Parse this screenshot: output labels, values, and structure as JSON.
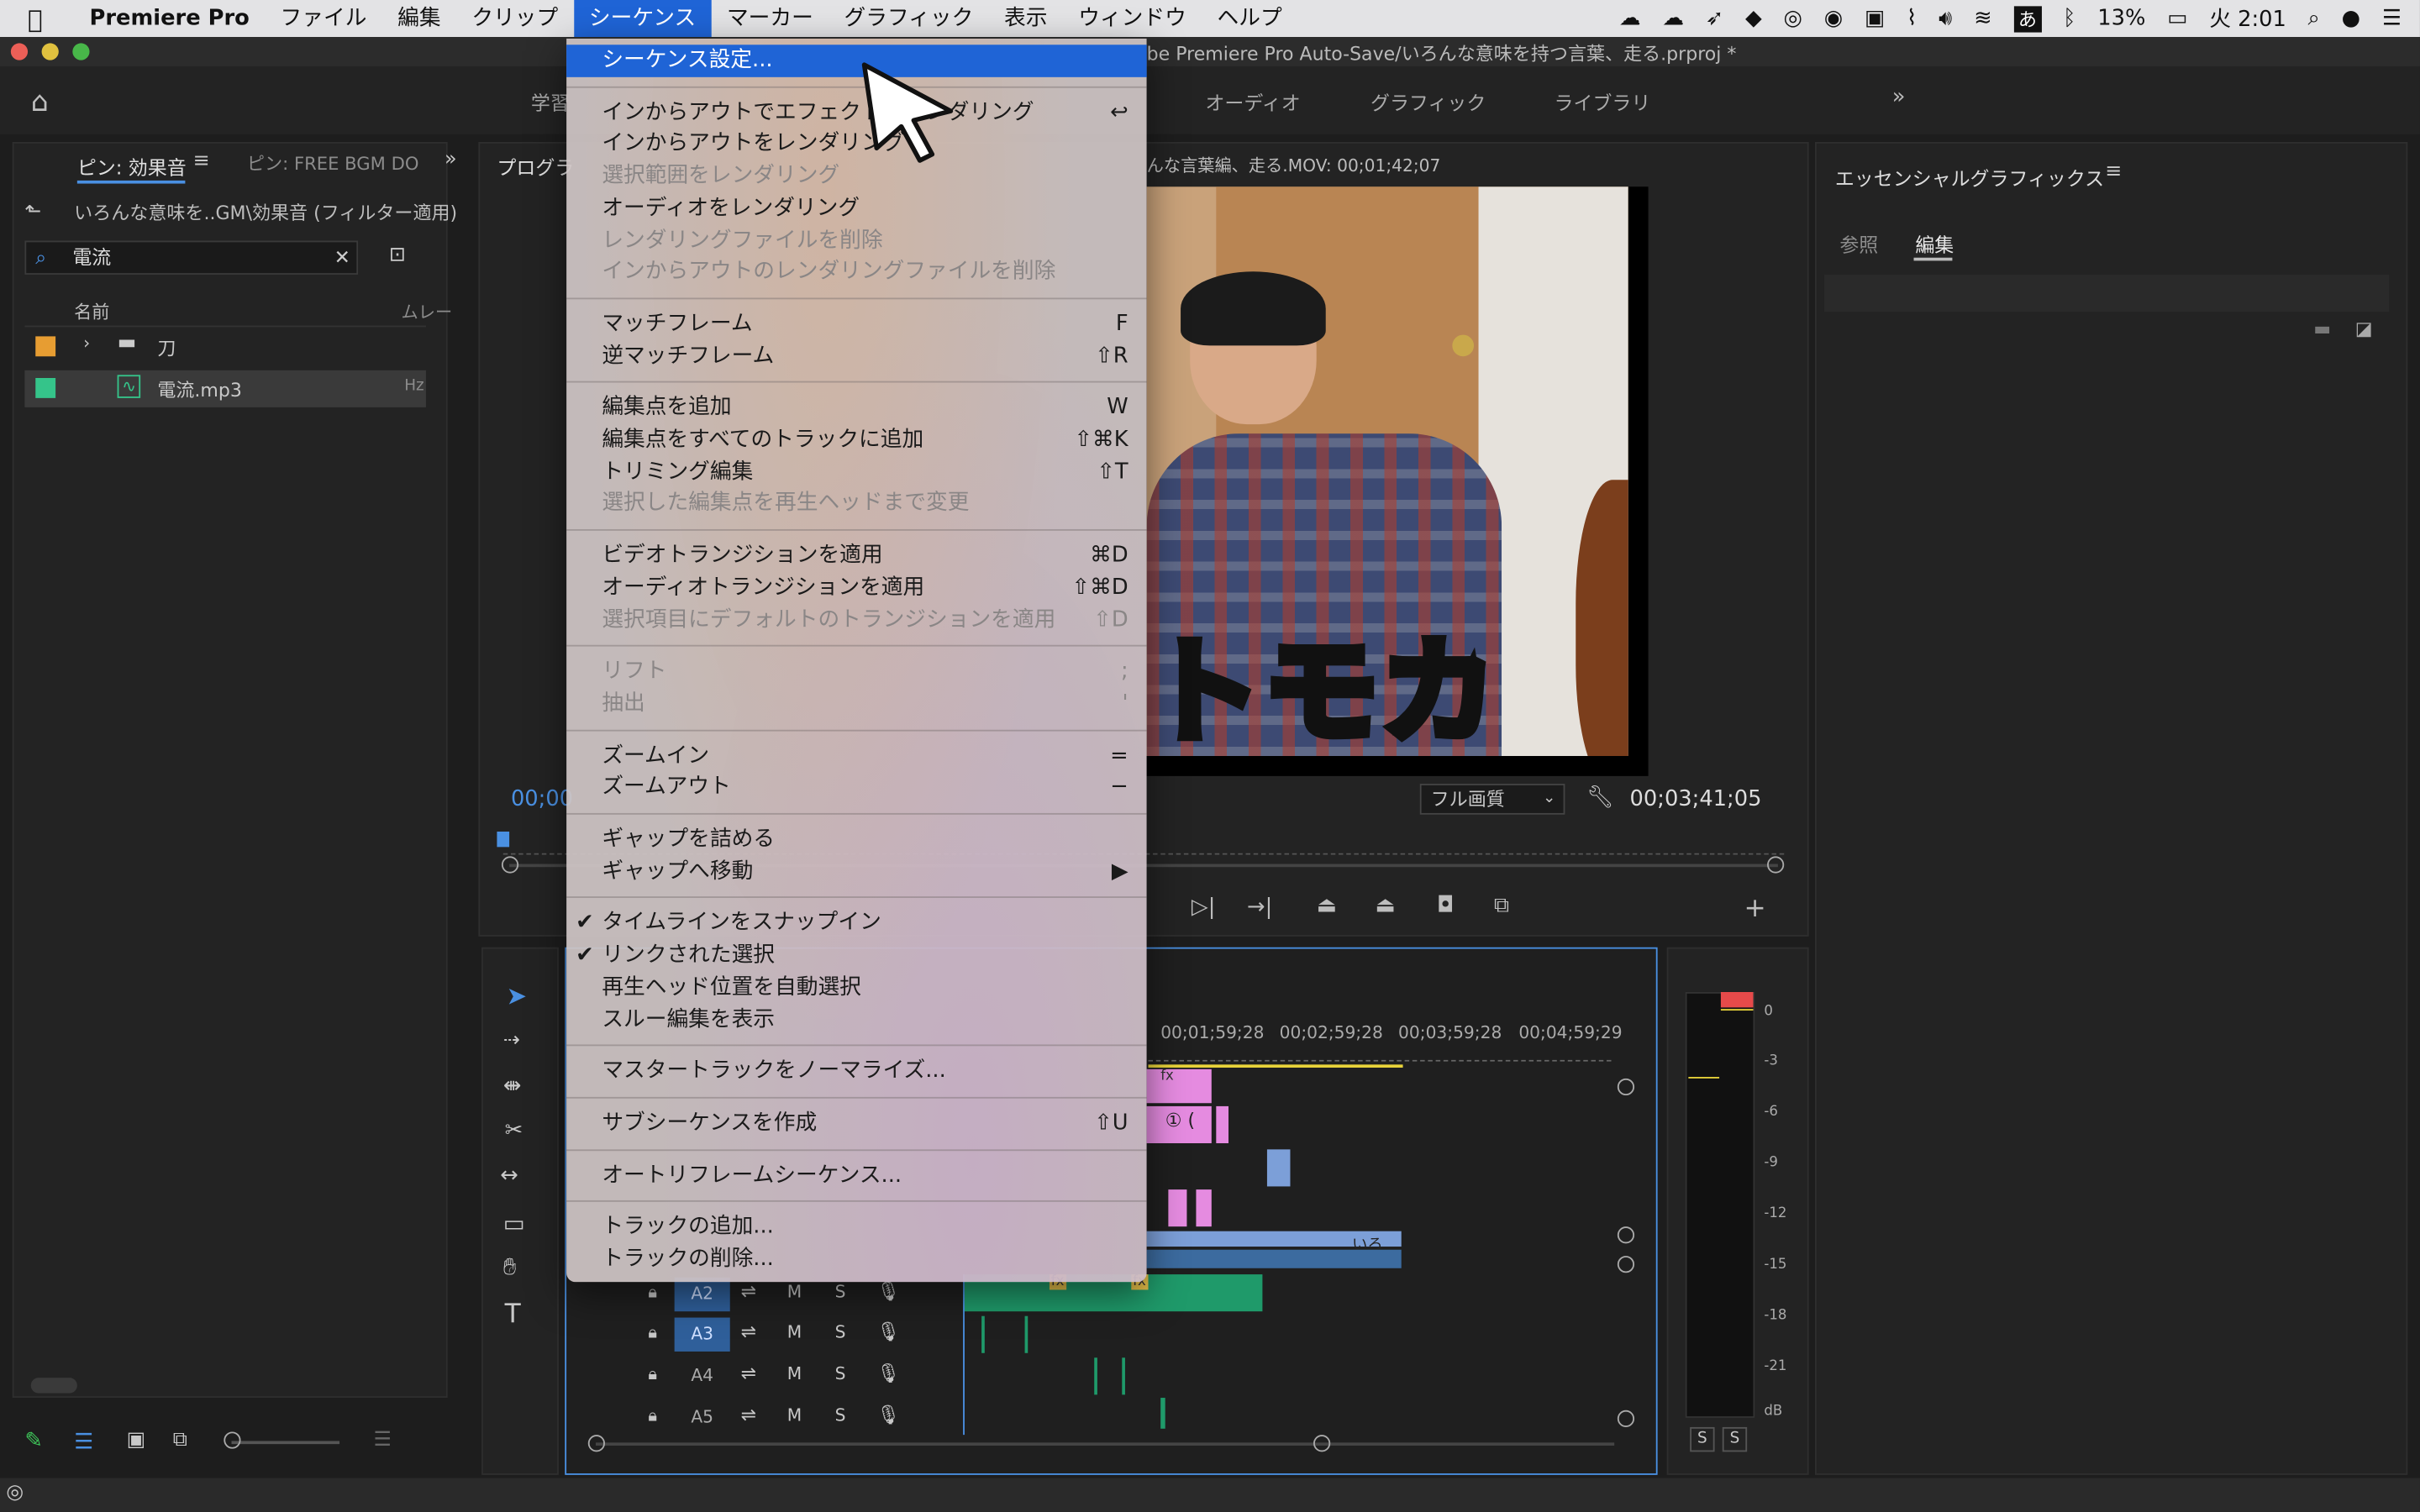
{
  "menubar": {
    "app_name": "Premiere Pro",
    "items": [
      "ファイル",
      "編集",
      "クリップ",
      "シーケンス",
      "マーカー",
      "グラフィック",
      "表示",
      "ウィンドウ",
      "ヘルプ"
    ],
    "active_item": "シーケンス",
    "battery": "13%",
    "ime": "あ",
    "clock": "火 2:01"
  },
  "window": {
    "title": "be Premiere Pro Auto-Save/いろんな意味を持つ言葉、走る.prproj *"
  },
  "workspaces": [
    "学習",
    "オーディオ",
    "グラフィック",
    "ライブラリ"
  ],
  "project": {
    "tab_active": "ピン: 効果音",
    "tab_other": "ピン: FREE BGM DO",
    "path": "いろんな意味を..GM\\効果音 (フィルター適用)",
    "search_value": "電流",
    "col_name": "名前",
    "col_frame": "ムレー",
    "rows": [
      {
        "name": "刀",
        "color": "#e79d32",
        "type": "folder"
      },
      {
        "name": "電流.mp3",
        "color": "#35c48a",
        "type": "audio",
        "extra": "Hz"
      }
    ]
  },
  "program": {
    "tab": "プログラ",
    "clip_title": "んな言葉編、走る.MOV: 00;01;42;07",
    "caption": "トモカ",
    "timecode_left": "00;00",
    "quality": "フル画質",
    "timecode_right": "00;03;41;05"
  },
  "essential_graphics": {
    "title": "エッセンシャルグラフィックス",
    "tab_browse": "参照",
    "tab_edit": "編集"
  },
  "timeline": {
    "ruler": [
      "00;01;59;28",
      "00;02;59;28",
      "00;03;59;28",
      "00;04;59;29"
    ],
    "tracks": [
      "A2",
      "A3",
      "A4",
      "A5"
    ],
    "track_m": "M",
    "track_s": "S",
    "clip_label_iro": "いろ",
    "clip_label_1": "① (",
    "fx": "fx"
  },
  "meter": {
    "scale": [
      "0",
      "-3",
      "-6",
      "-9",
      "-12",
      "-15",
      "-18",
      "-21",
      "dB"
    ],
    "solo_left": "S",
    "solo_right": "S"
  },
  "menu": {
    "sections": [
      [
        {
          "label": "シーケンス設定...",
          "selected": true
        }
      ],
      [
        {
          "label": "インからアウトでエフェクトをレンダリング",
          "shortcut": "↩"
        },
        {
          "label": "インからアウトをレンダリング"
        },
        {
          "label": "選択範囲をレンダリング",
          "disabled": true
        },
        {
          "label": "オーディオをレンダリング"
        },
        {
          "label": "レンダリングファイルを削除",
          "disabled": true
        },
        {
          "label": "インからアウトのレンダリングファイルを削除",
          "disabled": true
        }
      ],
      [
        {
          "label": "マッチフレーム",
          "shortcut": "F"
        },
        {
          "label": "逆マッチフレーム",
          "shortcut": "⇧R"
        }
      ],
      [
        {
          "label": "編集点を追加",
          "shortcut": "W"
        },
        {
          "label": "編集点をすべてのトラックに追加",
          "shortcut": "⇧⌘K"
        },
        {
          "label": "トリミング編集",
          "shortcut": "⇧T"
        },
        {
          "label": "選択した編集点を再生ヘッドまで変更",
          "disabled": true
        }
      ],
      [
        {
          "label": "ビデオトランジションを適用",
          "shortcut": "⌘D"
        },
        {
          "label": "オーディオトランジションを適用",
          "shortcut": "⇧⌘D"
        },
        {
          "label": "選択項目にデフォルトのトランジションを適用",
          "shortcut": "⇧D",
          "disabled": true
        }
      ],
      [
        {
          "label": "リフト",
          "shortcut": ";",
          "disabled": true
        },
        {
          "label": "抽出",
          "shortcut": "'",
          "disabled": true
        }
      ],
      [
        {
          "label": "ズームイン",
          "shortcut": "="
        },
        {
          "label": "ズームアウト",
          "shortcut": "−"
        }
      ],
      [
        {
          "label": "ギャップを詰める"
        },
        {
          "label": "ギャップへ移動",
          "shortcut": "▶"
        }
      ],
      [
        {
          "label": "タイムラインをスナップイン",
          "checked": true
        },
        {
          "label": "リンクされた選択",
          "checked": true
        },
        {
          "label": "再生ヘッド位置を自動選択"
        },
        {
          "label": "スルー編集を表示"
        }
      ],
      [
        {
          "label": "マスタートラックをノーマライズ..."
        }
      ],
      [
        {
          "label": "サブシーケンスを作成",
          "shortcut": "⇧U"
        }
      ],
      [
        {
          "label": "オートリフレームシーケンス..."
        }
      ],
      [
        {
          "label": "トラックの追加..."
        },
        {
          "label": "トラックの削除..."
        }
      ]
    ]
  },
  "colors": {
    "accent": "#1f64d6",
    "clip_pink": "#e58be0",
    "clip_blue": "#7c9fd8",
    "clip_green": "#1f9a6a",
    "meter_red": "#e64a4a"
  }
}
